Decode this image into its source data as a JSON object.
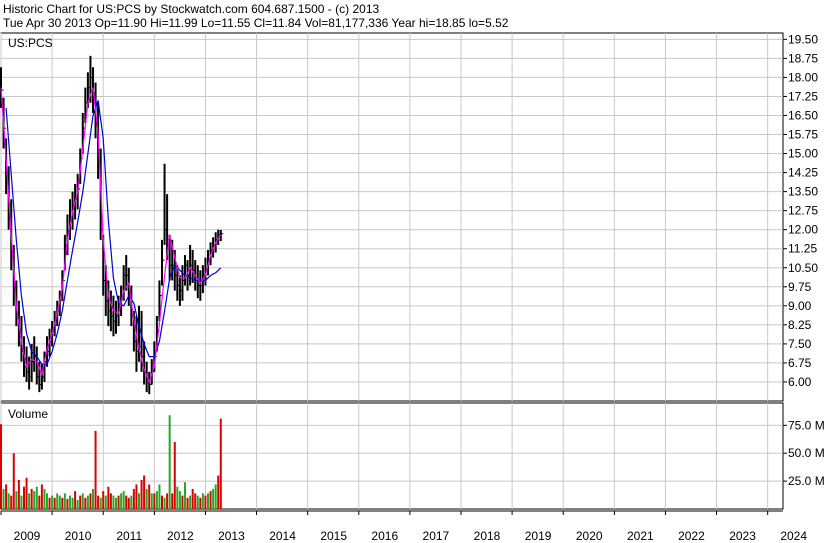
{
  "header": {
    "line1": "Historic Chart for US:PCS by Stockwatch.com 604.687.1500 - (c) 2013",
    "line2": "Tue Apr 30 2013   Op=11.90   Hi=11.99   Lo=11.55   Cl=11.84   Vol=81,177,336   Year hi=18.85   lo=5.52"
  },
  "colors": {
    "background": "#ffffff",
    "grid": "#c8c8c8",
    "price_bar": "#000000",
    "ma_short": "#ff00ff",
    "ma_long": "#0000dd",
    "vol_up": "#22aa22",
    "vol_down": "#dd0000"
  },
  "chart_data": [
    {
      "type": "line",
      "symbol_label": "US:PCS",
      "y_ticks": [
        "19.50",
        "18.75",
        "18.00",
        "17.25",
        "16.50",
        "15.75",
        "15.00",
        "14.25",
        "13.50",
        "12.75",
        "12.00",
        "11.25",
        "10.50",
        "9.75",
        "9.00",
        "8.25",
        "7.50",
        "6.75",
        "6.00"
      ],
      "ylim": [
        5.25,
        19.75
      ],
      "x_labels": [
        "2009",
        "2010",
        "2011",
        "2012",
        "2013",
        "2014",
        "2015",
        "2016",
        "2017",
        "2018",
        "2019",
        "2020",
        "2021",
        "2022",
        "2023",
        "2024"
      ],
      "xlim": [
        2009.0,
        2024.3
      ],
      "series": [
        {
          "style": "price-bars",
          "x": [
            2009.0,
            2009.05,
            2009.1,
            2009.15,
            2009.2,
            2009.25,
            2009.3,
            2009.35,
            2009.4,
            2009.45,
            2009.5,
            2009.55,
            2009.6,
            2009.65,
            2009.7,
            2009.75,
            2009.8,
            2009.85,
            2009.9,
            2009.95,
            2010.0,
            2010.05,
            2010.1,
            2010.15,
            2010.2,
            2010.25,
            2010.3,
            2010.35,
            2010.4,
            2010.45,
            2010.5,
            2010.55,
            2010.6,
            2010.65,
            2010.7,
            2010.75,
            2010.8,
            2010.85,
            2010.9,
            2010.95,
            2011.0,
            2011.05,
            2011.1,
            2011.15,
            2011.2,
            2011.25,
            2011.3,
            2011.35,
            2011.4,
            2011.45,
            2011.5,
            2011.55,
            2011.6,
            2011.65,
            2011.7,
            2011.75,
            2011.8,
            2011.85,
            2011.9,
            2011.95,
            2012.0,
            2012.05,
            2012.1,
            2012.15,
            2012.2,
            2012.25,
            2012.3,
            2012.35,
            2012.4,
            2012.45,
            2012.5,
            2012.55,
            2012.6,
            2012.65,
            2012.7,
            2012.75,
            2012.8,
            2012.85,
            2012.9,
            2012.95,
            2013.0,
            2013.05,
            2013.1,
            2013.15,
            2013.2,
            2013.25,
            2013.3
          ],
          "high": [
            18.4,
            17.2,
            15.6,
            14.5,
            13.2,
            11.4,
            10.0,
            9.2,
            8.6,
            7.8,
            7.4,
            7.0,
            7.5,
            7.8,
            7.4,
            6.8,
            6.7,
            7.2,
            7.8,
            8.1,
            8.4,
            8.8,
            9.2,
            9.6,
            10.4,
            11.8,
            12.6,
            13.2,
            13.5,
            13.8,
            14.2,
            15.2,
            16.6,
            17.6,
            18.2,
            18.85,
            18.4,
            17.8,
            17.0,
            15.2,
            11.8,
            10.6,
            10.0,
            9.6,
            9.4,
            9.2,
            9.4,
            9.8,
            10.6,
            11.0,
            10.5,
            9.8,
            8.8,
            8.6,
            9.0,
            8.8,
            7.6,
            6.8,
            6.4,
            6.9,
            7.6,
            8.6,
            10.0,
            11.6,
            14.6,
            13.4,
            11.8,
            11.6,
            11.2,
            10.6,
            10.2,
            10.6,
            11.0,
            10.8,
            11.4,
            11.2,
            10.8,
            10.6,
            10.4,
            10.6,
            10.9,
            11.2,
            11.5,
            11.7,
            11.9,
            12.0,
            11.99
          ],
          "low": [
            16.8,
            15.2,
            13.4,
            12.0,
            10.4,
            9.0,
            8.2,
            7.4,
            6.8,
            6.2,
            6.0,
            5.7,
            6.0,
            6.4,
            5.9,
            5.6,
            5.7,
            6.0,
            6.6,
            7.0,
            7.4,
            7.8,
            8.2,
            8.6,
            9.2,
            10.4,
            11.0,
            11.6,
            12.0,
            12.4,
            12.8,
            13.8,
            15.0,
            16.2,
            16.8,
            17.0,
            16.6,
            15.6,
            14.0,
            11.6,
            9.4,
            8.6,
            8.2,
            8.0,
            7.8,
            7.9,
            8.2,
            8.6,
            9.2,
            9.6,
            9.0,
            8.2,
            7.2,
            6.4,
            6.8,
            6.4,
            5.9,
            5.6,
            5.52,
            5.9,
            6.4,
            7.2,
            8.4,
            9.8,
            11.4,
            10.8,
            10.0,
            10.0,
            9.6,
            9.2,
            9.0,
            9.2,
            9.8,
            9.6,
            9.8,
            9.9,
            9.6,
            9.3,
            9.2,
            9.5,
            9.8,
            10.2,
            10.6,
            10.9,
            11.1,
            11.4,
            11.55
          ],
          "close": [
            17.5,
            16.0,
            14.2,
            13.0,
            11.0,
            9.6,
            8.6,
            7.8,
            7.2,
            6.6,
            6.4,
            6.2,
            6.8,
            7.0,
            6.2,
            5.9,
            6.2,
            6.8,
            7.2,
            7.6,
            8.0,
            8.4,
            8.8,
            9.2,
            10.0,
            11.4,
            11.8,
            12.4,
            12.8,
            13.2,
            13.6,
            14.8,
            16.0,
            17.0,
            17.6,
            18.0,
            17.4,
            16.4,
            14.8,
            12.0,
            10.0,
            9.2,
            8.8,
            8.6,
            8.4,
            8.6,
            8.8,
            9.4,
            10.2,
            10.2,
            9.4,
            8.6,
            7.6,
            7.2,
            7.4,
            7.0,
            6.4,
            6.0,
            5.9,
            6.4,
            7.0,
            8.0,
            9.4,
            10.8,
            12.0,
            11.6,
            10.6,
            10.6,
            10.2,
            9.8,
            9.6,
            10.0,
            10.6,
            10.2,
            10.6,
            10.4,
            10.0,
            9.8,
            9.8,
            10.2,
            10.4,
            10.8,
            11.2,
            11.4,
            11.6,
            11.8,
            11.84
          ]
        },
        {
          "name": "",
          "style": "ma_short",
          "x": [
            2009.0,
            2009.1,
            2009.2,
            2009.3,
            2009.4,
            2009.5,
            2009.6,
            2009.7,
            2009.8,
            2009.9,
            2010.0,
            2010.1,
            2010.2,
            2010.3,
            2010.4,
            2010.5,
            2010.6,
            2010.7,
            2010.8,
            2010.9,
            2011.0,
            2011.1,
            2011.2,
            2011.3,
            2011.4,
            2011.5,
            2011.6,
            2011.7,
            2011.8,
            2011.9,
            2012.0,
            2012.1,
            2012.2,
            2012.3,
            2012.4,
            2012.5,
            2012.6,
            2012.7,
            2012.8,
            2012.9,
            2013.0,
            2013.1,
            2013.2,
            2013.3
          ],
          "values": [
            17.6,
            14.8,
            11.8,
            9.0,
            7.6,
            6.6,
            6.9,
            6.8,
            6.3,
            7.3,
            7.9,
            8.7,
            9.7,
            11.6,
            12.7,
            13.5,
            15.2,
            17.0,
            17.6,
            15.8,
            11.6,
            9.4,
            8.8,
            8.7,
            9.6,
            9.9,
            8.4,
            7.3,
            6.5,
            6.0,
            6.6,
            8.3,
            10.2,
            11.8,
            10.9,
            10.1,
            10.1,
            10.5,
            10.2,
            9.9,
            10.2,
            11.0,
            11.5,
            11.8
          ]
        },
        {
          "name": "",
          "style": "ma_long",
          "x": [
            2009.1,
            2009.2,
            2009.3,
            2009.4,
            2009.5,
            2009.6,
            2009.7,
            2009.8,
            2009.9,
            2010.0,
            2010.1,
            2010.2,
            2010.3,
            2010.4,
            2010.5,
            2010.6,
            2010.7,
            2010.8,
            2010.9,
            2011.0,
            2011.1,
            2011.2,
            2011.3,
            2011.4,
            2011.5,
            2011.6,
            2011.7,
            2011.8,
            2011.9,
            2012.0,
            2012.1,
            2012.2,
            2012.3,
            2012.4,
            2012.5,
            2012.6,
            2012.7,
            2012.8,
            2012.9,
            2013.0,
            2013.1,
            2013.2,
            2013.3
          ],
          "values": [
            16.8,
            14.2,
            11.6,
            9.4,
            7.9,
            7.2,
            7.0,
            6.7,
            6.7,
            7.2,
            7.9,
            8.8,
            10.0,
            11.2,
            12.3,
            13.5,
            15.0,
            16.5,
            17.1,
            15.6,
            12.4,
            10.1,
            9.1,
            9.0,
            9.4,
            9.1,
            8.2,
            7.5,
            7.0,
            7.0,
            7.6,
            8.8,
            10.1,
            10.6,
            10.4,
            10.2,
            10.1,
            10.0,
            10.0,
            10.0,
            10.2,
            10.3,
            10.5
          ]
        }
      ]
    },
    {
      "type": "bar",
      "title": "Volume",
      "y_ticks": [
        "75.0 M",
        "50.0 M",
        "25.0 M"
      ],
      "ylim": [
        0,
        95
      ],
      "unit": "M",
      "x": [
        2009.0,
        2009.05,
        2009.1,
        2009.15,
        2009.2,
        2009.25,
        2009.3,
        2009.35,
        2009.4,
        2009.45,
        2009.5,
        2009.55,
        2009.6,
        2009.65,
        2009.7,
        2009.75,
        2009.8,
        2009.85,
        2009.9,
        2009.95,
        2010.0,
        2010.05,
        2010.1,
        2010.15,
        2010.2,
        2010.25,
        2010.3,
        2010.35,
        2010.4,
        2010.45,
        2010.5,
        2010.55,
        2010.6,
        2010.65,
        2010.7,
        2010.75,
        2010.8,
        2010.85,
        2010.9,
        2010.95,
        2011.0,
        2011.05,
        2011.1,
        2011.15,
        2011.2,
        2011.25,
        2011.3,
        2011.35,
        2011.4,
        2011.45,
        2011.5,
        2011.55,
        2011.6,
        2011.65,
        2011.7,
        2011.75,
        2011.8,
        2011.85,
        2011.9,
        2011.95,
        2012.0,
        2012.05,
        2012.1,
        2012.15,
        2012.2,
        2012.25,
        2012.3,
        2012.35,
        2012.4,
        2012.45,
        2012.5,
        2012.55,
        2012.6,
        2012.65,
        2012.7,
        2012.75,
        2012.8,
        2012.85,
        2012.9,
        2012.95,
        2013.0,
        2013.05,
        2013.1,
        2013.15,
        2013.2,
        2013.25,
        2013.3
      ],
      "values": [
        76,
        18,
        22,
        14,
        12,
        50,
        16,
        26,
        12,
        20,
        28,
        14,
        18,
        16,
        20,
        12,
        22,
        18,
        14,
        10,
        12,
        10,
        14,
        12,
        10,
        14,
        9,
        12,
        10,
        16,
        8,
        12,
        14,
        10,
        12,
        14,
        18,
        70,
        12,
        10,
        16,
        12,
        20,
        14,
        12,
        10,
        12,
        14,
        16,
        12,
        10,
        12,
        18,
        22,
        14,
        26,
        30,
        18,
        22,
        14,
        14,
        16,
        22,
        12,
        10,
        14,
        84,
        14,
        60,
        20,
        16,
        12,
        24,
        10,
        12,
        18,
        14,
        12,
        10,
        14,
        12,
        14,
        16,
        18,
        22,
        30,
        81
      ],
      "up": [
        false,
        true,
        false,
        true,
        false,
        false,
        true,
        false,
        true,
        false,
        false,
        true,
        false,
        true,
        true,
        false,
        false,
        true,
        true,
        false,
        true,
        false,
        true,
        true,
        false,
        true,
        false,
        true,
        true,
        false,
        true,
        false,
        true,
        false,
        true,
        false,
        true,
        false,
        false,
        true,
        false,
        true,
        false,
        false,
        true,
        true,
        false,
        true,
        true,
        false,
        false,
        true,
        false,
        false,
        true,
        false,
        false,
        true,
        false,
        true,
        false,
        true,
        true,
        false,
        true,
        false,
        true,
        false,
        false,
        true,
        true,
        false,
        true,
        false,
        true,
        false,
        false,
        true,
        false,
        true,
        false,
        true,
        false,
        true,
        true,
        false,
        false
      ]
    }
  ]
}
